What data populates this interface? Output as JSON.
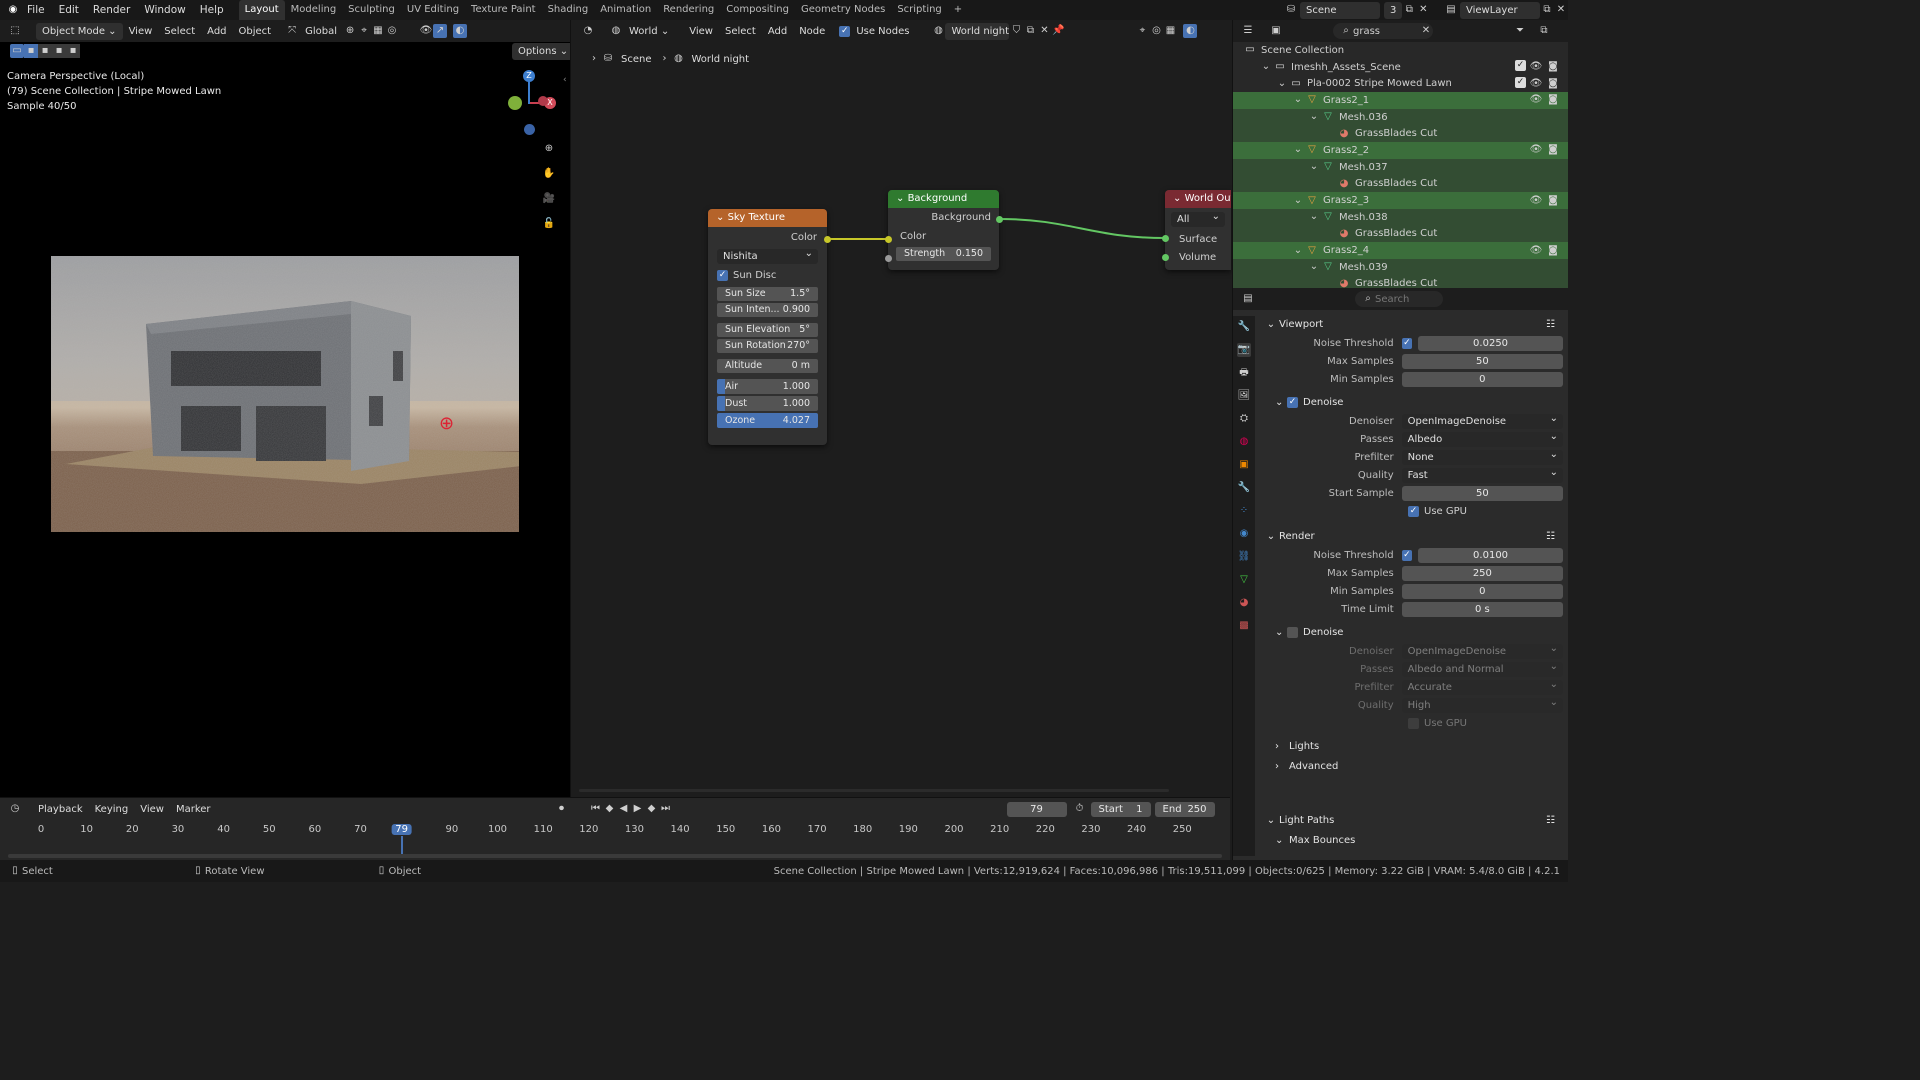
{
  "menu": {
    "items": [
      "File",
      "Edit",
      "Render",
      "Window",
      "Help"
    ],
    "workspaces": [
      "Layout",
      "Modeling",
      "Sculpting",
      "UV Editing",
      "Texture Paint",
      "Shading",
      "Animation",
      "Rendering",
      "Compositing",
      "Geometry Nodes",
      "Scripting"
    ],
    "active_workspace": "Layout",
    "add_tab": "+",
    "scene_name": "Scene",
    "scene_count": "3",
    "view_layer": "ViewLayer"
  },
  "viewport": {
    "mode": "Object Mode",
    "menus": [
      "View",
      "Select",
      "Add",
      "Object"
    ],
    "transform": "Global",
    "options": "Options",
    "overlay_lines": [
      "Camera Perspective (Local)",
      "(79) Scene Collection | Stripe Mowed Lawn",
      "Sample 40/50"
    ],
    "gizmo": {
      "z": "Z",
      "x": "X"
    }
  },
  "node_editor": {
    "world_type": "World",
    "menus": [
      "View",
      "Select",
      "Add",
      "Node"
    ],
    "use_nodes_label": "Use Nodes",
    "world_name": "World night",
    "breadcrumb": [
      "Scene",
      "World night"
    ],
    "sky_node": {
      "title": "Sky Texture",
      "output": "Color",
      "type": "Nishita",
      "sun_disc": "Sun Disc",
      "fields": [
        {
          "label": "Sun Size",
          "value": "1.5°"
        },
        {
          "label": "Sun Inten...",
          "value": "0.900"
        },
        {
          "label": "Sun Elevation",
          "value": "5°"
        },
        {
          "label": "Sun Rotation",
          "value": "270°"
        },
        {
          "label": "Altitude",
          "value": "0 m"
        }
      ],
      "sliders": [
        {
          "label": "Air",
          "value": "1.000"
        },
        {
          "label": "Dust",
          "value": "1.000"
        },
        {
          "label": "Ozone",
          "value": "4.027"
        }
      ]
    },
    "bg_node": {
      "title": "Background",
      "output": "Background",
      "input": "Color",
      "strength_label": "Strength",
      "strength": "0.150"
    },
    "wo_node": {
      "title": "World Outp",
      "target": "All",
      "inputs": [
        "Surface",
        "Volume"
      ]
    }
  },
  "outliner": {
    "search": "grass",
    "rows": [
      {
        "label": "Scene Collection",
        "indent": 0,
        "icon": "collection-icon",
        "cls": ""
      },
      {
        "label": "Imeshh_Assets_Scene",
        "indent": 1,
        "icon": "collection-icon",
        "cls": ""
      },
      {
        "label": "Pla-0002 Stripe Mowed Lawn",
        "indent": 2,
        "icon": "collection-icon",
        "cls": ""
      },
      {
        "label": "Grass2_1",
        "indent": 3,
        "icon": "object-icon",
        "cls": "act"
      },
      {
        "label": "Mesh.036",
        "indent": 4,
        "icon": "mesh-icon",
        "cls": "sel"
      },
      {
        "label": "GrassBlades Cut",
        "indent": 5,
        "icon": "material-icon",
        "cls": "sel"
      },
      {
        "label": "Grass2_2",
        "indent": 3,
        "icon": "object-icon",
        "cls": "act"
      },
      {
        "label": "Mesh.037",
        "indent": 4,
        "icon": "mesh-icon",
        "cls": "sel"
      },
      {
        "label": "GrassBlades Cut",
        "indent": 5,
        "icon": "material-icon",
        "cls": "sel"
      },
      {
        "label": "Grass2_3",
        "indent": 3,
        "icon": "object-icon",
        "cls": "act"
      },
      {
        "label": "Mesh.038",
        "indent": 4,
        "icon": "mesh-icon",
        "cls": "sel"
      },
      {
        "label": "GrassBlades Cut",
        "indent": 5,
        "icon": "material-icon",
        "cls": "sel"
      },
      {
        "label": "Grass2_4",
        "indent": 3,
        "icon": "object-icon",
        "cls": "act"
      },
      {
        "label": "Mesh.039",
        "indent": 4,
        "icon": "mesh-icon",
        "cls": "sel"
      },
      {
        "label": "GrassBlades Cut",
        "indent": 5,
        "icon": "material-icon",
        "cls": "sel"
      }
    ]
  },
  "properties": {
    "search_placeholder": "Search",
    "viewport_section": "Viewport",
    "render_section": "Render",
    "denoise_label": "Denoise",
    "vp": {
      "noise_threshold": {
        "label": "Noise Threshold",
        "value": "0.0250"
      },
      "max_samples": {
        "label": "Max Samples",
        "value": "50"
      },
      "min_samples": {
        "label": "Min Samples",
        "value": "0"
      },
      "denoiser": {
        "label": "Denoiser",
        "value": "OpenImageDenoise"
      },
      "passes": {
        "label": "Passes",
        "value": "Albedo"
      },
      "prefilter": {
        "label": "Prefilter",
        "value": "None"
      },
      "quality": {
        "label": "Quality",
        "value": "Fast"
      },
      "start_sample": {
        "label": "Start Sample",
        "value": "50"
      },
      "use_gpu": "Use GPU"
    },
    "rd": {
      "noise_threshold": {
        "label": "Noise Threshold",
        "value": "0.0100"
      },
      "max_samples": {
        "label": "Max Samples",
        "value": "250"
      },
      "min_samples": {
        "label": "Min Samples",
        "value": "0"
      },
      "time_limit": {
        "label": "Time Limit",
        "value": "0 s"
      },
      "denoiser": {
        "label": "Denoiser",
        "value": "OpenImageDenoise"
      },
      "passes": {
        "label": "Passes",
        "value": "Albedo and Normal"
      },
      "prefilter": {
        "label": "Prefilter",
        "value": "Accurate"
      },
      "quality": {
        "label": "Quality",
        "value": "High"
      },
      "use_gpu": "Use GPU"
    },
    "collapsed": [
      "Lights",
      "Advanced"
    ],
    "light_paths": "Light Paths",
    "max_bounces": "Max Bounces"
  },
  "timeline": {
    "menus": [
      "Playback",
      "Keying",
      "View",
      "Marker"
    ],
    "current_frame": "79",
    "start_label": "Start",
    "start": "1",
    "end_label": "End",
    "end": "250",
    "ticks": [
      "0",
      "10",
      "20",
      "30",
      "40",
      "50",
      "60",
      "70",
      "79",
      "90",
      "100",
      "110",
      "120",
      "130",
      "140",
      "150",
      "160",
      "170",
      "180",
      "190",
      "200",
      "210",
      "220",
      "230",
      "240",
      "250"
    ]
  },
  "status": {
    "hints": [
      "Select",
      "Rotate View",
      "Object"
    ],
    "stats": "Scene Collection | Stripe Mowed Lawn | Verts:12,919,624 | Faces:10,096,986 | Tris:19,511,099 | Objects:0/625 | Memory: 3.22 GiB | VRAM: 5.4/8.0 GiB | 4.2.1"
  },
  "colors": {
    "accent": "#4772b3",
    "sky_header": "#b5632a",
    "bg_header": "#2f7a2f",
    "wo_header": "#7a2a32",
    "color_link": "#c7c729",
    "shader_link": "#63c763",
    "selection": "#3b6e3b"
  }
}
